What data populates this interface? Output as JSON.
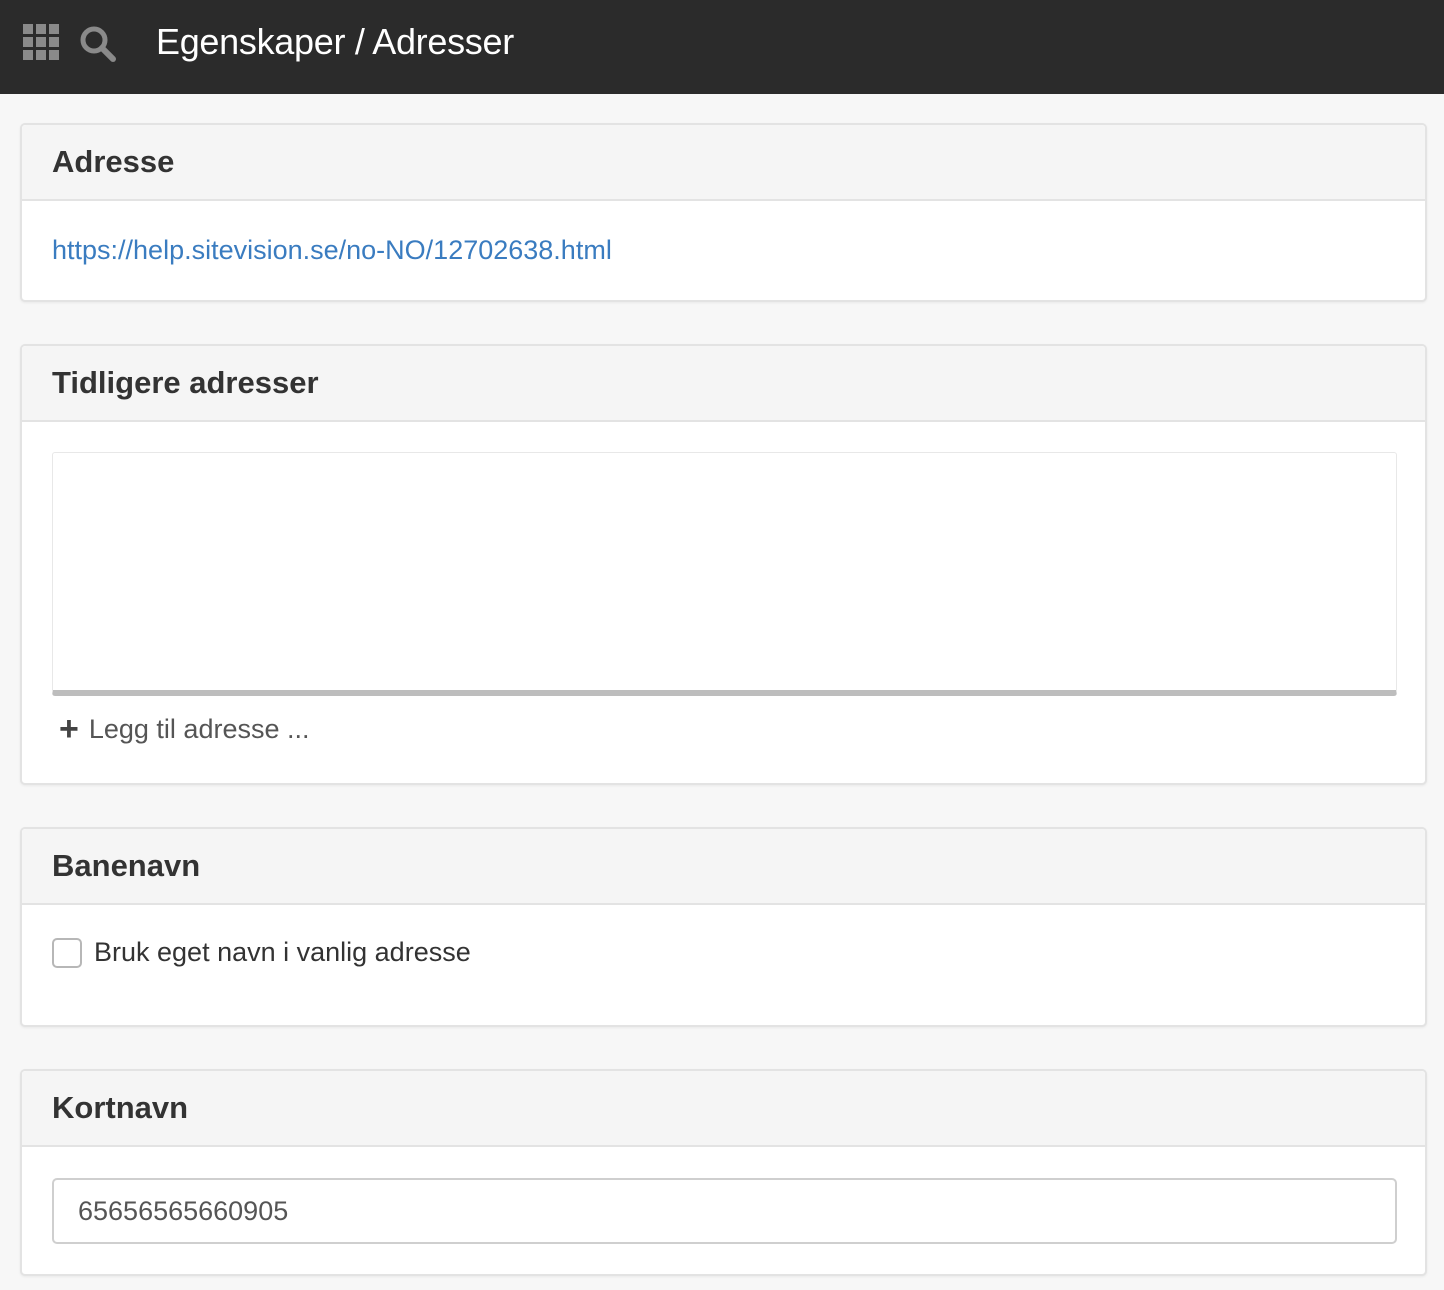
{
  "topbar": {
    "title": "Egenskaper / Adresser",
    "apps_icon": "grid-icon",
    "search_icon": "search-icon",
    "background_color": "#2b2b2b"
  },
  "sections": {
    "address": {
      "title": "Adresse",
      "url": "https://help.sitevision.se/no-NO/12702638.html",
      "link_color": "#3a7cc0"
    },
    "previous_addresses": {
      "title": "Tidligere adresser",
      "items": [],
      "add_label": "Legg til adresse ...",
      "add_icon": "plus-icon"
    },
    "pathname": {
      "title": "Banenavn",
      "checkbox_label": "Bruk eget navn i vanlig adresse",
      "checked": false
    },
    "shortname": {
      "title": "Kortnavn",
      "value": "65656565660905"
    }
  }
}
